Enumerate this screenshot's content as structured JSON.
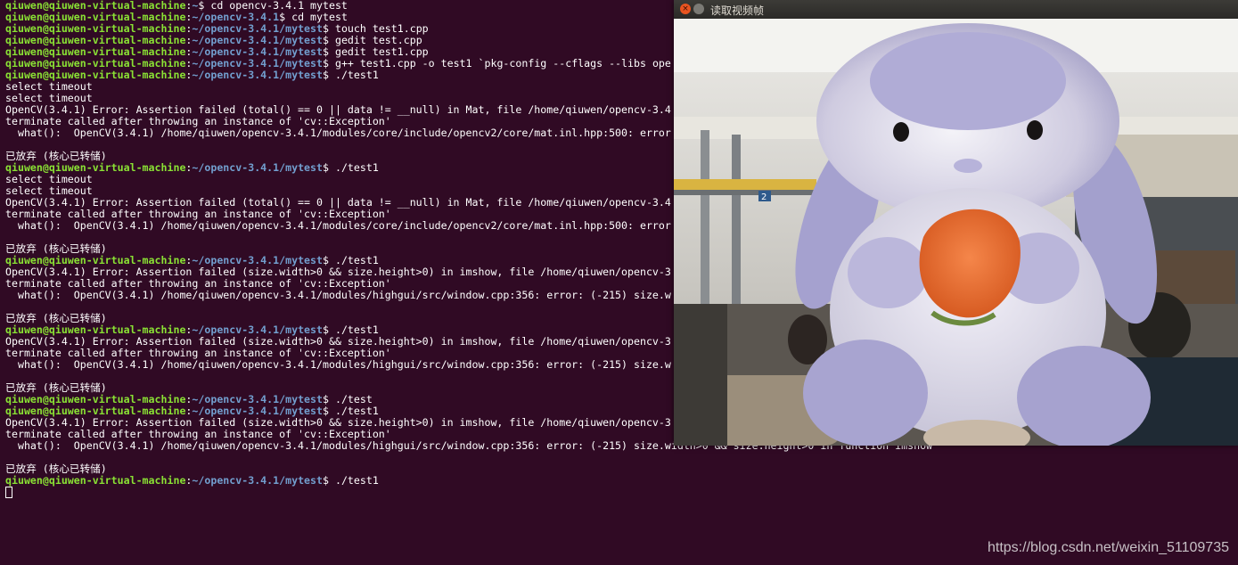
{
  "terminal": {
    "prompt_user": "qiuwen@qiuwen-virtual-machine",
    "lines": [
      {
        "path": "~",
        "cmd": " cd opencv-3.4.1 mytest"
      },
      {
        "path": "~/opencv-3.4.1",
        "cmd": " cd mytest"
      },
      {
        "path": "~/opencv-3.4.1/mytest",
        "cmd": " touch test1.cpp"
      },
      {
        "path": "~/opencv-3.4.1/mytest",
        "cmd": " gedit test.cpp"
      },
      {
        "path": "~/opencv-3.4.1/mytest",
        "cmd": " gedit test1.cpp"
      },
      {
        "path": "~/opencv-3.4.1/mytest",
        "cmd": " g++ test1.cpp -o test1 `pkg-config --cflags --libs ope"
      },
      {
        "path": "~/opencv-3.4.1/mytest",
        "cmd": " ./test1"
      },
      {
        "text": "select timeout"
      },
      {
        "text": "select timeout"
      },
      {
        "text": "OpenCV(3.4.1) Error: Assertion failed (total() == 0 || data != __null) in Mat, file /home/qiuwen/opencv-3.4"
      },
      {
        "text": "terminate called after throwing an instance of 'cv::Exception'"
      },
      {
        "text": "  what():  OpenCV(3.4.1) /home/qiuwen/opencv-3.4.1/modules/core/include/opencv2/core/mat.inl.hpp:500: error"
      },
      {
        "text": ""
      },
      {
        "text": "已放弃 (核心已转储)"
      },
      {
        "path": "~/opencv-3.4.1/mytest",
        "cmd": " ./test1"
      },
      {
        "text": "select timeout"
      },
      {
        "text": "select timeout"
      },
      {
        "text": "OpenCV(3.4.1) Error: Assertion failed (total() == 0 || data != __null) in Mat, file /home/qiuwen/opencv-3.4"
      },
      {
        "text": "terminate called after throwing an instance of 'cv::Exception'"
      },
      {
        "text": "  what():  OpenCV(3.4.1) /home/qiuwen/opencv-3.4.1/modules/core/include/opencv2/core/mat.inl.hpp:500: error"
      },
      {
        "text": ""
      },
      {
        "text": "已放弃 (核心已转储)"
      },
      {
        "path": "~/opencv-3.4.1/mytest",
        "cmd": " ./test1"
      },
      {
        "text": "OpenCV(3.4.1) Error: Assertion failed (size.width>0 && size.height>0) in imshow, file /home/qiuwen/opencv-3"
      },
      {
        "text": "terminate called after throwing an instance of 'cv::Exception'"
      },
      {
        "text": "  what():  OpenCV(3.4.1) /home/qiuwen/opencv-3.4.1/modules/highgui/src/window.cpp:356: error: (-215) size.w"
      },
      {
        "text": ""
      },
      {
        "text": "已放弃 (核心已转储)"
      },
      {
        "path": "~/opencv-3.4.1/mytest",
        "cmd": " ./test1"
      },
      {
        "text": "OpenCV(3.4.1) Error: Assertion failed (size.width>0 && size.height>0) in imshow, file /home/qiuwen/opencv-3"
      },
      {
        "text": "terminate called after throwing an instance of 'cv::Exception'"
      },
      {
        "text": "  what():  OpenCV(3.4.1) /home/qiuwen/opencv-3.4.1/modules/highgui/src/window.cpp:356: error: (-215) size.w"
      },
      {
        "text": ""
      },
      {
        "text": "已放弃 (核心已转储)"
      },
      {
        "path": "~/opencv-3.4.1/mytest",
        "cmd": " ./test"
      },
      {
        "path": "~/opencv-3.4.1/mytest",
        "cmd": " ./test1"
      },
      {
        "text": "OpenCV(3.4.1) Error: Assertion failed (size.width>0 && size.height>0) in imshow, file /home/qiuwen/opencv-3"
      },
      {
        "text": "terminate called after throwing an instance of 'cv::Exception'"
      },
      {
        "text": "  what():  OpenCV(3.4.1) /home/qiuwen/opencv-3.4.1/modules/highgui/src/window.cpp:356: error: (-215) size.width>0 && size.height>0 in function imshow"
      },
      {
        "text": ""
      },
      {
        "text": "已放弃 (核心已转储)"
      },
      {
        "path": "~/opencv-3.4.1/mytest",
        "cmd": " ./test1"
      },
      {
        "cursor": true
      }
    ]
  },
  "video_window": {
    "title": "读取视频帧",
    "close_glyph": "×"
  },
  "watermark": "https://blog.csdn.net/weixin_51109735",
  "colors": {
    "terminal_bg": "#300a24",
    "prompt_user": "#8ae234",
    "prompt_path": "#729fcf",
    "close_button": "#e95420"
  },
  "icons": [
    "close-icon",
    "minimize-icon",
    "terminal-cursor"
  ]
}
